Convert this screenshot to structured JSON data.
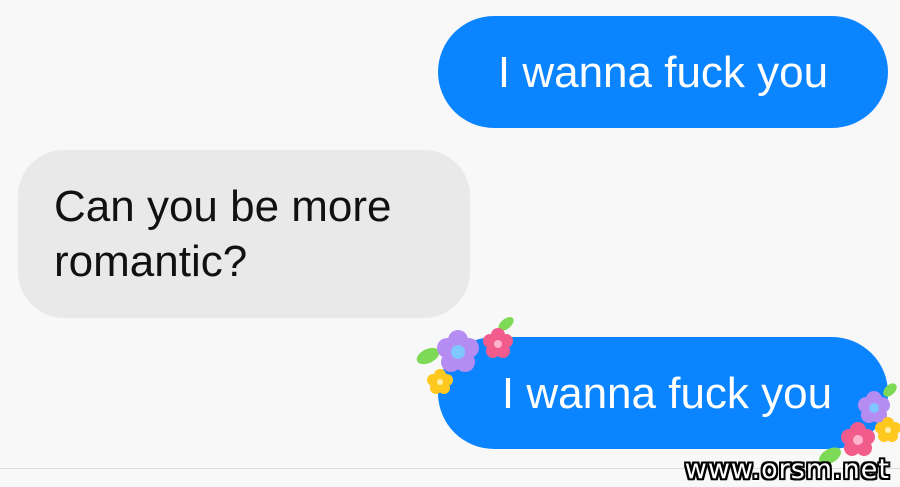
{
  "messages": [
    {
      "sender": "self",
      "text": "I wanna fuck you"
    },
    {
      "sender": "other",
      "text": "Can you be more romantic?"
    },
    {
      "sender": "self",
      "text": "I wanna fuck you",
      "decoration": "flower-icon"
    }
  ],
  "watermark": "www.orsm.net",
  "colors": {
    "outgoing_bubble": "#0b84ff",
    "incoming_bubble": "#e9e9e9",
    "background": "#f8f8f8"
  }
}
